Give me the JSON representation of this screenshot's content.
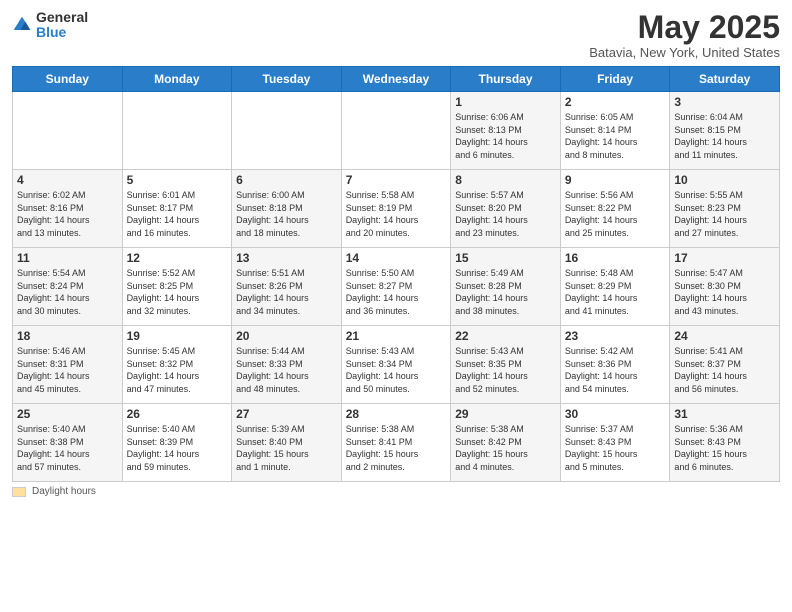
{
  "header": {
    "logo_general": "General",
    "logo_blue": "Blue",
    "title": "May 2025",
    "location": "Batavia, New York, United States"
  },
  "legend": {
    "label": "Daylight hours"
  },
  "days_of_week": [
    "Sunday",
    "Monday",
    "Tuesday",
    "Wednesday",
    "Thursday",
    "Friday",
    "Saturday"
  ],
  "weeks": [
    [
      {
        "day": "",
        "text": ""
      },
      {
        "day": "",
        "text": ""
      },
      {
        "day": "",
        "text": ""
      },
      {
        "day": "",
        "text": ""
      },
      {
        "day": "1",
        "text": "Sunrise: 6:06 AM\nSunset: 8:13 PM\nDaylight: 14 hours\nand 6 minutes."
      },
      {
        "day": "2",
        "text": "Sunrise: 6:05 AM\nSunset: 8:14 PM\nDaylight: 14 hours\nand 8 minutes."
      },
      {
        "day": "3",
        "text": "Sunrise: 6:04 AM\nSunset: 8:15 PM\nDaylight: 14 hours\nand 11 minutes."
      }
    ],
    [
      {
        "day": "4",
        "text": "Sunrise: 6:02 AM\nSunset: 8:16 PM\nDaylight: 14 hours\nand 13 minutes."
      },
      {
        "day": "5",
        "text": "Sunrise: 6:01 AM\nSunset: 8:17 PM\nDaylight: 14 hours\nand 16 minutes."
      },
      {
        "day": "6",
        "text": "Sunrise: 6:00 AM\nSunset: 8:18 PM\nDaylight: 14 hours\nand 18 minutes."
      },
      {
        "day": "7",
        "text": "Sunrise: 5:58 AM\nSunset: 8:19 PM\nDaylight: 14 hours\nand 20 minutes."
      },
      {
        "day": "8",
        "text": "Sunrise: 5:57 AM\nSunset: 8:20 PM\nDaylight: 14 hours\nand 23 minutes."
      },
      {
        "day": "9",
        "text": "Sunrise: 5:56 AM\nSunset: 8:22 PM\nDaylight: 14 hours\nand 25 minutes."
      },
      {
        "day": "10",
        "text": "Sunrise: 5:55 AM\nSunset: 8:23 PM\nDaylight: 14 hours\nand 27 minutes."
      }
    ],
    [
      {
        "day": "11",
        "text": "Sunrise: 5:54 AM\nSunset: 8:24 PM\nDaylight: 14 hours\nand 30 minutes."
      },
      {
        "day": "12",
        "text": "Sunrise: 5:52 AM\nSunset: 8:25 PM\nDaylight: 14 hours\nand 32 minutes."
      },
      {
        "day": "13",
        "text": "Sunrise: 5:51 AM\nSunset: 8:26 PM\nDaylight: 14 hours\nand 34 minutes."
      },
      {
        "day": "14",
        "text": "Sunrise: 5:50 AM\nSunset: 8:27 PM\nDaylight: 14 hours\nand 36 minutes."
      },
      {
        "day": "15",
        "text": "Sunrise: 5:49 AM\nSunset: 8:28 PM\nDaylight: 14 hours\nand 38 minutes."
      },
      {
        "day": "16",
        "text": "Sunrise: 5:48 AM\nSunset: 8:29 PM\nDaylight: 14 hours\nand 41 minutes."
      },
      {
        "day": "17",
        "text": "Sunrise: 5:47 AM\nSunset: 8:30 PM\nDaylight: 14 hours\nand 43 minutes."
      }
    ],
    [
      {
        "day": "18",
        "text": "Sunrise: 5:46 AM\nSunset: 8:31 PM\nDaylight: 14 hours\nand 45 minutes."
      },
      {
        "day": "19",
        "text": "Sunrise: 5:45 AM\nSunset: 8:32 PM\nDaylight: 14 hours\nand 47 minutes."
      },
      {
        "day": "20",
        "text": "Sunrise: 5:44 AM\nSunset: 8:33 PM\nDaylight: 14 hours\nand 48 minutes."
      },
      {
        "day": "21",
        "text": "Sunrise: 5:43 AM\nSunset: 8:34 PM\nDaylight: 14 hours\nand 50 minutes."
      },
      {
        "day": "22",
        "text": "Sunrise: 5:43 AM\nSunset: 8:35 PM\nDaylight: 14 hours\nand 52 minutes."
      },
      {
        "day": "23",
        "text": "Sunrise: 5:42 AM\nSunset: 8:36 PM\nDaylight: 14 hours\nand 54 minutes."
      },
      {
        "day": "24",
        "text": "Sunrise: 5:41 AM\nSunset: 8:37 PM\nDaylight: 14 hours\nand 56 minutes."
      }
    ],
    [
      {
        "day": "25",
        "text": "Sunrise: 5:40 AM\nSunset: 8:38 PM\nDaylight: 14 hours\nand 57 minutes."
      },
      {
        "day": "26",
        "text": "Sunrise: 5:40 AM\nSunset: 8:39 PM\nDaylight: 14 hours\nand 59 minutes."
      },
      {
        "day": "27",
        "text": "Sunrise: 5:39 AM\nSunset: 8:40 PM\nDaylight: 15 hours\nand 1 minute."
      },
      {
        "day": "28",
        "text": "Sunrise: 5:38 AM\nSunset: 8:41 PM\nDaylight: 15 hours\nand 2 minutes."
      },
      {
        "day": "29",
        "text": "Sunrise: 5:38 AM\nSunset: 8:42 PM\nDaylight: 15 hours\nand 4 minutes."
      },
      {
        "day": "30",
        "text": "Sunrise: 5:37 AM\nSunset: 8:43 PM\nDaylight: 15 hours\nand 5 minutes."
      },
      {
        "day": "31",
        "text": "Sunrise: 5:36 AM\nSunset: 8:43 PM\nDaylight: 15 hours\nand 6 minutes."
      }
    ]
  ]
}
